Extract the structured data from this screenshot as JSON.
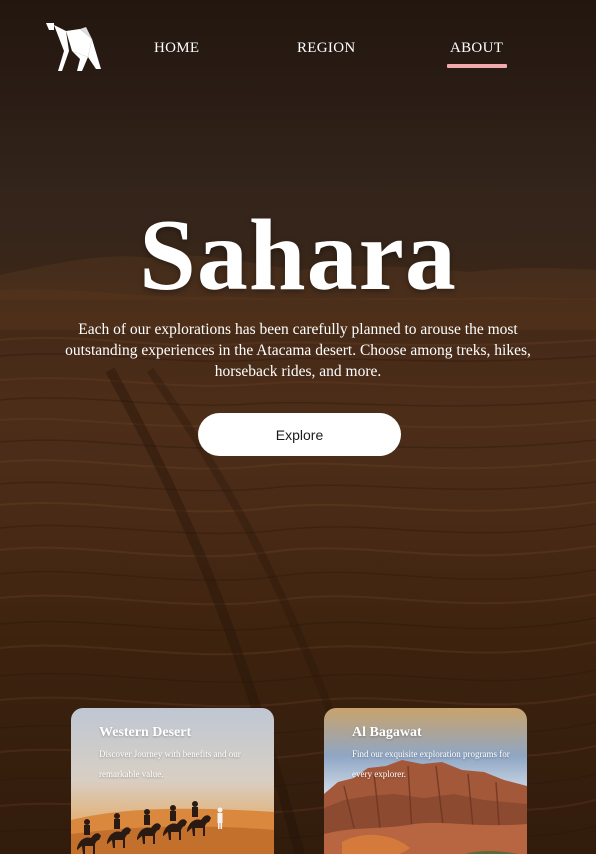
{
  "nav": {
    "logo_icon": "camel-logo-icon",
    "items": [
      {
        "label": "HOME"
      },
      {
        "label": "REGION"
      },
      {
        "label": "ABOUT",
        "active": true
      }
    ],
    "active_underline_color": "#f1a9ae"
  },
  "hero": {
    "title": "Sahara",
    "description": "Each of our explorations has been carefully planned to arouse the most outstanding experiences in the Atacama desert. Choose among treks, hikes, horseback rides, and more.",
    "button_label": "Explore"
  },
  "cards": [
    {
      "title": "Western Desert",
      "description": "Discover Journey with benefits and our remarkable value."
    },
    {
      "title": "Al Bagawat",
      "description": "Find our exquisite exploration programs for every explorer."
    }
  ],
  "colors": {
    "background_desert": "#4a2d19",
    "button_bg": "#ffffff",
    "button_text": "#1b1b1b"
  }
}
